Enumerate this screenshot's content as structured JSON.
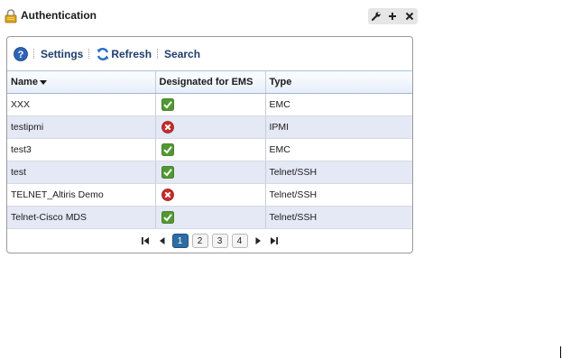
{
  "portlet": {
    "title": "Authentication",
    "controls": [
      "wrench-icon",
      "plus-icon",
      "close-icon"
    ]
  },
  "toolbar": {
    "help_icon": "help-icon",
    "settings_label": "Settings",
    "refresh_label": "Refresh",
    "search_label": "Search"
  },
  "table": {
    "columns": [
      "Name",
      "Designated for EMS",
      "Type"
    ],
    "sort": "Name descending",
    "rows": [
      {
        "name": "XXX",
        "ems": "yes",
        "type": "EMC"
      },
      {
        "name": "testipmi",
        "ems": "no",
        "type": "IPMI"
      },
      {
        "name": "test3",
        "ems": "yes",
        "type": "EMC"
      },
      {
        "name": "test",
        "ems": "yes",
        "type": "Telnet/SSH"
      },
      {
        "name": "TELNET_Altiris Demo",
        "ems": "no",
        "type": "Telnet/SSH"
      },
      {
        "name": "Telnet-Cisco MDS",
        "ems": "yes",
        "type": "Telnet/SSH"
      }
    ]
  },
  "pager": {
    "pages": [
      "1",
      "2",
      "3",
      "4"
    ],
    "current": "1"
  },
  "colors": {
    "accent": "#1f3d6b",
    "check_green": "#4f9a2f",
    "error_red": "#c62b2b",
    "active_page": "#2e6da4"
  }
}
